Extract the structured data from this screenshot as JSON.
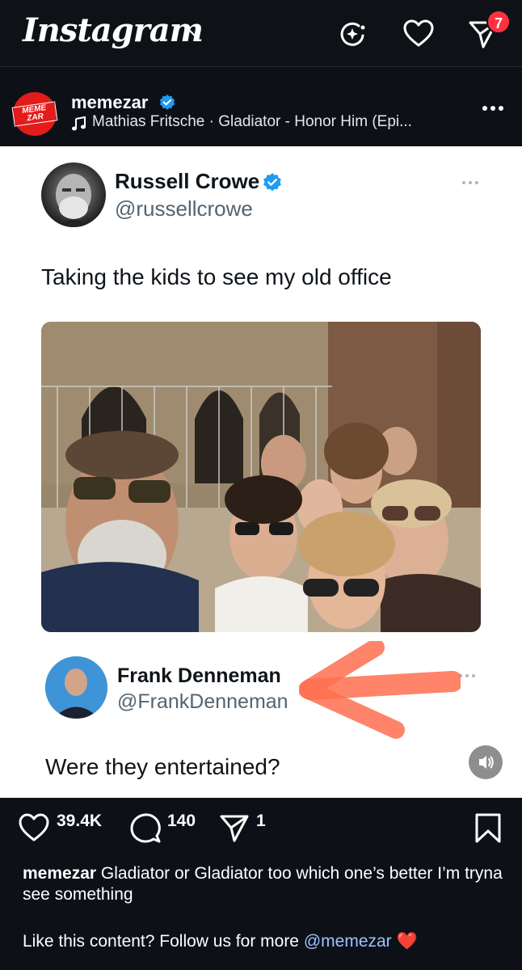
{
  "app": {
    "logo_text": "Instagram"
  },
  "header": {
    "notification_count": "7"
  },
  "post": {
    "username": "memezar",
    "avatar_text": "MEME ZAR",
    "music": "Mathias Fritsche · Gladiator - Honor Him (Epi..."
  },
  "tweet": {
    "name": "Russell Crowe",
    "handle": "@russellcrowe",
    "text": "Taking the kids to see my old office"
  },
  "reply": {
    "name": "Frank Denneman",
    "handle": "@FrankDenneman",
    "text": "Were they entertained?"
  },
  "actions": {
    "likes": "39.4K",
    "comments": "140",
    "shares": "1"
  },
  "caption": {
    "username": "memezar",
    "text": "Gladiator or Gladiator too which one’s better I’m tryna see something",
    "cta": "Like this content? Follow us for more",
    "mention": "@memezar",
    "emoji": "❤️"
  },
  "colors": {
    "background": "#0d1117",
    "badge": "#ff3040",
    "verified": "#1d9bf0",
    "arrow": "#ff6f4f",
    "mention": "#9ec0ff"
  }
}
